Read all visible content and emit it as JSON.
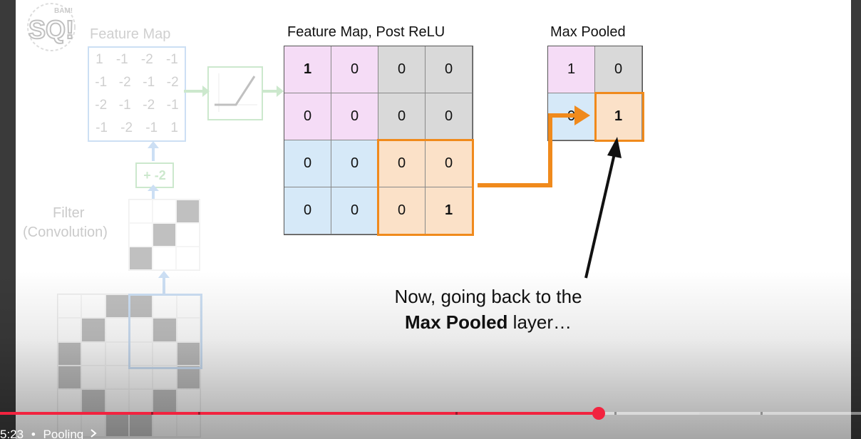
{
  "left_panel": {
    "feature_map_label": "Feature Map",
    "feature_map_rows": [
      [
        "1",
        "-1",
        "-2",
        "-1"
      ],
      [
        "-1",
        "-2",
        "-1",
        "-2"
      ],
      [
        "-2",
        "-1",
        "-2",
        "-1"
      ],
      [
        "-1",
        "-2",
        "-1",
        "1"
      ]
    ],
    "bias_label": "+ -2",
    "filter_label_line1": "Filter",
    "filter_label_line2": "(Convolution)"
  },
  "feature_map_post_relu": {
    "title": "Feature Map, Post ReLU",
    "rows": [
      [
        "1",
        "0",
        "0",
        "0"
      ],
      [
        "0",
        "0",
        "0",
        "0"
      ],
      [
        "0",
        "0",
        "0",
        "0"
      ],
      [
        "0",
        "0",
        "0",
        "1"
      ]
    ]
  },
  "max_pooled": {
    "title": "Max Pooled",
    "rows": [
      [
        "1",
        "0"
      ],
      [
        "0",
        "1"
      ]
    ]
  },
  "caption": {
    "line1": "Now, going back to the",
    "line2_bold": "Max Pooled",
    "line2_rest": " layer…"
  },
  "logo": {
    "text": "SQ!",
    "small_text": "BAM!"
  },
  "player": {
    "time": "5:23",
    "separator": "•",
    "chapter": "Pooling",
    "chevron_icon": "chevron-right-icon",
    "played_fraction": 0.695,
    "buffered_fraction": 0.812,
    "accent_color": "#f2233f"
  }
}
